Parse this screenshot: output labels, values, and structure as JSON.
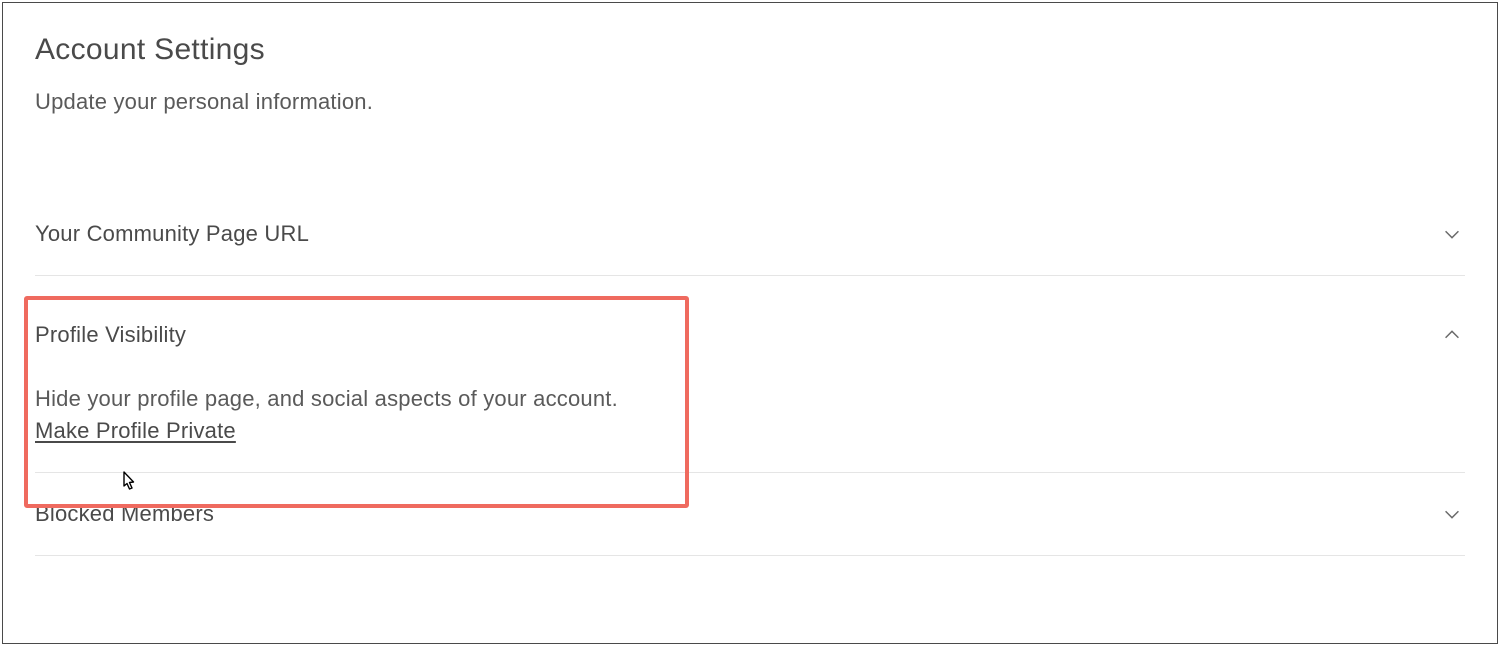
{
  "header": {
    "title": "Account Settings",
    "subtitle": "Update your personal information."
  },
  "sections": [
    {
      "title": "Your Community Page URL",
      "expanded": false
    },
    {
      "title": "Profile Visibility",
      "expanded": true,
      "description": "Hide your profile page, and social aspects of your account.",
      "action_label": "Make Profile Private"
    },
    {
      "title": "Blocked Members",
      "expanded": false
    }
  ],
  "annotation": {
    "highlight_color": "#ef6a5f"
  }
}
